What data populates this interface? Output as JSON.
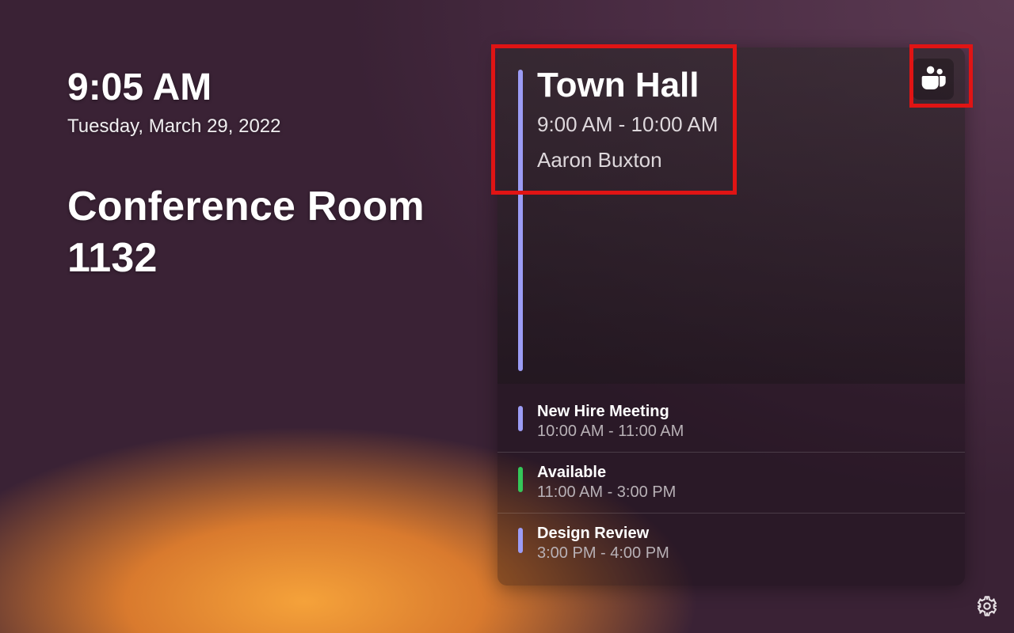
{
  "clock": {
    "time": "9:05 AM",
    "date": "Tuesday, March 29, 2022"
  },
  "room": {
    "name": "Conference Room 1132"
  },
  "current_meeting": {
    "title": "Town Hall",
    "time_range": "9:00 AM - 10:00 AM",
    "organizer": "Aaron Buxton",
    "accent_color": "#9c9cf5"
  },
  "upcoming": [
    {
      "title": "New Hire Meeting",
      "time_range": "10:00 AM - 11:00 AM",
      "status": "busy",
      "accent_color": "#9c9cf5"
    },
    {
      "title": "Available",
      "time_range": "11:00 AM - 3:00 PM",
      "status": "free",
      "accent_color": "#34c759"
    },
    {
      "title": "Design Review",
      "time_range": "3:00 PM - 4:00 PM",
      "status": "busy",
      "accent_color": "#9c9cf5"
    }
  ],
  "icons": {
    "teams": "teams-icon",
    "settings": "gear-icon"
  },
  "highlight_boxes": [
    {
      "target": "current-meeting-header"
    },
    {
      "target": "teams-button"
    }
  ]
}
